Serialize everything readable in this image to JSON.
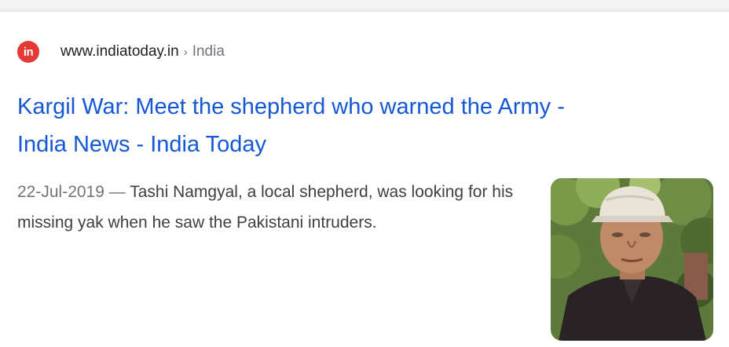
{
  "result": {
    "favicon_text": "in",
    "domain": "www.indiatoday.in",
    "separator": "›",
    "breadcrumb": "India",
    "title_line1": "Kargil War: Meet the shepherd who warned the Army -",
    "title_line2": "India News - India Today",
    "date": "22-Jul-2019 —",
    "snippet": "Tashi Namgyal, a local shepherd, was looking for his missing yak when he saw the Pakistani intruders.",
    "thumbnail_icon": "photo-of-man-in-cap"
  },
  "colors": {
    "link": "#1558d6",
    "favicon": "#e53935",
    "muted": "#70757a",
    "text": "#3c4043"
  }
}
